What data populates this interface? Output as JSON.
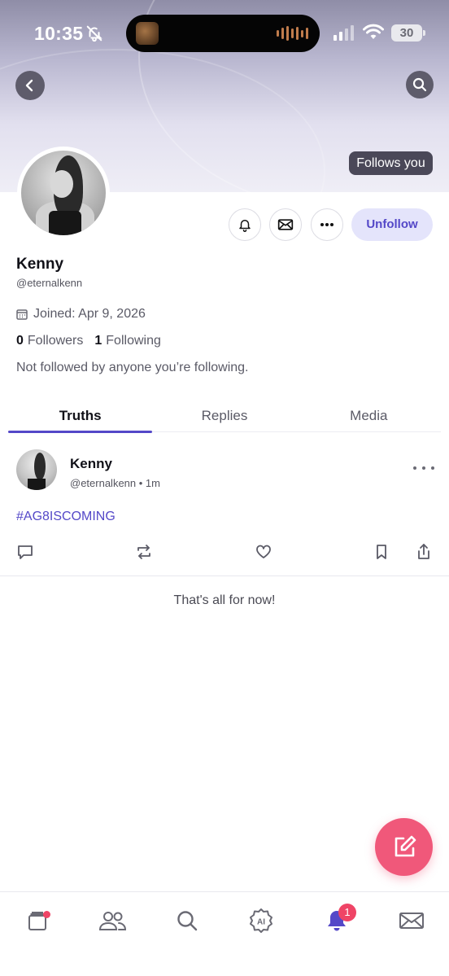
{
  "status_bar": {
    "time": "10:35",
    "battery": "30"
  },
  "header": {
    "follows_you": "Follows you"
  },
  "profile": {
    "name": "Kenny",
    "handle": "@eternalkenn",
    "joined": "Joined: Apr 9, 2026",
    "followers_count": "0",
    "followers_label": "Followers",
    "following_count": "1",
    "following_label": "Following",
    "mutuals_text": "Not followed by anyone you’re following.",
    "unfollow_label": "Unfollow"
  },
  "tabs": [
    {
      "label": "Truths",
      "active": true
    },
    {
      "label": "Replies",
      "active": false
    },
    {
      "label": "Media",
      "active": false
    }
  ],
  "post": {
    "author": "Kenny",
    "meta": "@eternalkenn • 1m",
    "text": "#AG8ISCOMING"
  },
  "feed_end_message": "That's all for now!",
  "bottom_nav": {
    "notifications_badge": "1",
    "items": [
      "feed-icon",
      "people-icon",
      "search-icon",
      "ai-icon",
      "bell-icon",
      "mail-icon"
    ]
  },
  "colors": {
    "accent": "#5448c8",
    "fab": "#f0587a",
    "badge": "#ef4466"
  }
}
